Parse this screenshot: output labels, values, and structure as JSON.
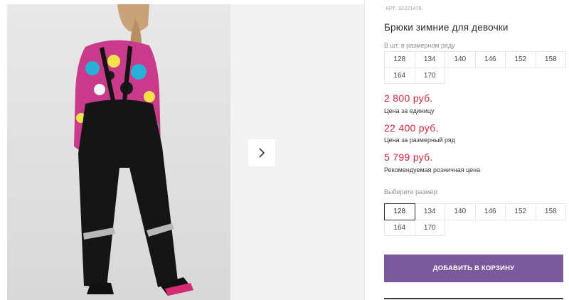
{
  "product": {
    "art_label": "АРТ:",
    "art_number": "32221478",
    "title": "Брюки зимние для девочки"
  },
  "row_sizes": {
    "label": "В шт. в размерном ряду",
    "items": [
      "128",
      "134",
      "140",
      "146",
      "152",
      "158",
      "164",
      "170"
    ]
  },
  "prices": {
    "unit_price": "2 800 руб.",
    "unit_caption": "Цена за единицу",
    "row_price": "22 400 руб.",
    "row_caption": "Цена за размерный ряд",
    "retail_price": "5 799 руб.",
    "retail_caption": "Рекомендуемая розничная цена"
  },
  "size_select": {
    "label": "Выберите размер:",
    "selected": "128",
    "items": [
      "128",
      "134",
      "140",
      "146",
      "152",
      "158",
      "164",
      "170"
    ]
  },
  "cart": {
    "button_label": "ДОБАВИТЬ В КОРЗИНУ"
  },
  "gallery": {
    "next_icon": "chevron-right-icon"
  },
  "colors": {
    "price": "#d4243b",
    "button": "#7a5a9c"
  }
}
